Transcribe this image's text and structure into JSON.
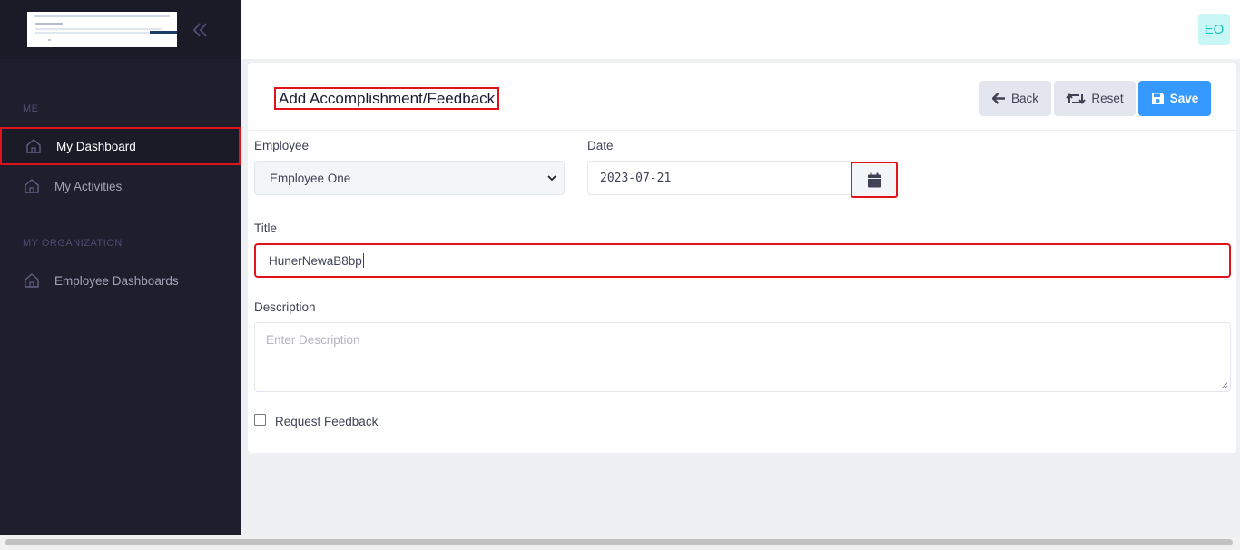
{
  "sidebar": {
    "logo_alt": "logo",
    "sections": [
      {
        "label": "ME"
      },
      {
        "label": "MY ORGANIZATION"
      }
    ],
    "items": [
      {
        "label": "My Dashboard",
        "icon": "home-icon",
        "active": true
      },
      {
        "label": "My Activities",
        "icon": "home-icon",
        "active": false
      },
      {
        "label": "Employee Dashboards",
        "icon": "home-icon",
        "active": false
      }
    ]
  },
  "topbar": {
    "avatar_initials": "EO"
  },
  "card": {
    "title": "Add Accomplishment/Feedback",
    "buttons": {
      "back": "Back",
      "reset": "Reset",
      "save": "Save"
    }
  },
  "form": {
    "employee_label": "Employee",
    "employee_value": "Employee One",
    "date_label": "Date",
    "date_value": "2023-07-21",
    "title_label": "Title",
    "title_value": "HunerNewaB8bp",
    "description_label": "Description",
    "description_placeholder": "Enter Description",
    "request_feedback_label": "Request Feedback",
    "request_feedback_checked": false
  },
  "colors": {
    "sidebar_bg": "#1e1e2d",
    "primary": "#3699ff",
    "highlight": "#e0121b",
    "avatar_bg": "#c9f7f5",
    "avatar_text": "#1bc5bd"
  }
}
